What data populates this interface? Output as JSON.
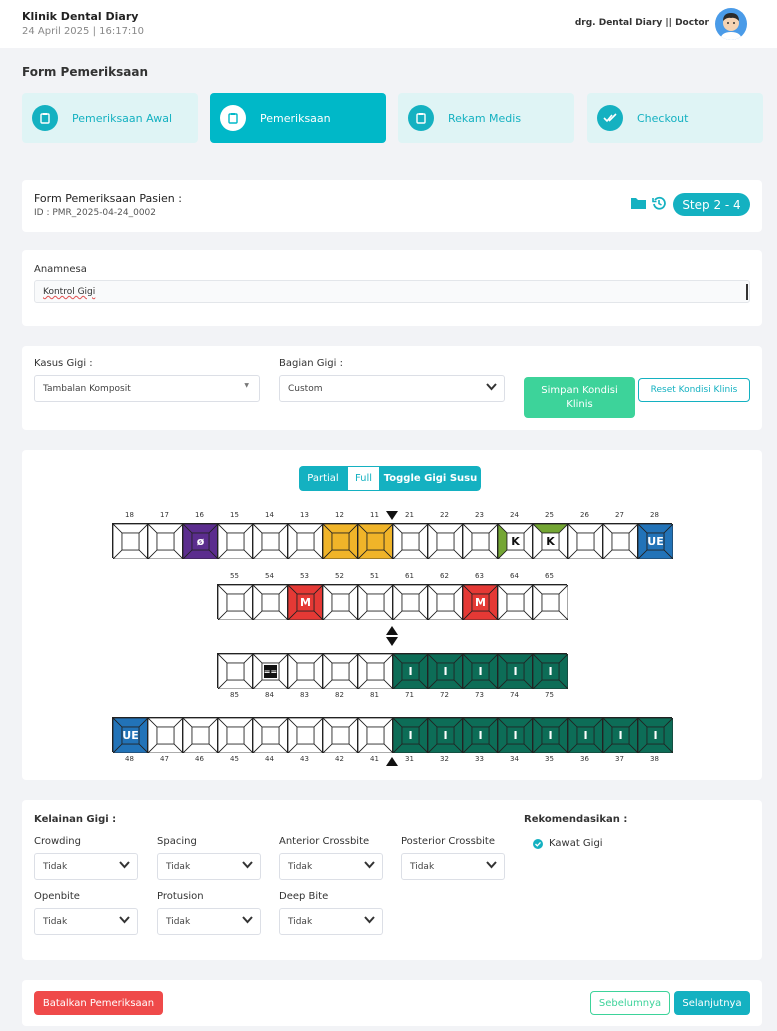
{
  "header": {
    "clinic": "Klinik Dental Diary",
    "datetime": "24 April 2025 | 16:17:10",
    "user": "drg. Dental Diary || Doctor"
  },
  "page_title": "Form Pemeriksaan",
  "steps": [
    {
      "label": "Pemeriksaan Awal"
    },
    {
      "label": "Pemeriksaan"
    },
    {
      "label": "Rekam Medis"
    },
    {
      "label": "Checkout"
    }
  ],
  "patient": {
    "title": "Form Pemeriksaan Pasien :",
    "id": "ID : PMR_2025-04-24_0002",
    "step": "Step 2 - 4"
  },
  "anamnesa": {
    "label": "Anamnesa",
    "value": "Kontrol Gigi"
  },
  "kasus": {
    "label": "Kasus Gigi :",
    "value": "Tambalan Komposit"
  },
  "bagian": {
    "label": "Bagian Gigi :",
    "value": "Custom"
  },
  "buttons": {
    "simpan": "Simpan Kondisi Klinis",
    "reset": "Reset Kondisi Klinis",
    "batal": "Batalkan Pemeriksaan",
    "prev": "Sebelumnya",
    "next": "Selanjutnya"
  },
  "toggle": {
    "partial": "Partial",
    "full": "Full",
    "susu": "Toggle Gigi Susu"
  },
  "odontogram": {
    "row1": [
      {
        "n": "18"
      },
      {
        "n": "17"
      },
      {
        "n": "16",
        "c": "#5b2d8e",
        "m": "ø"
      },
      {
        "n": "15"
      },
      {
        "n": "14"
      },
      {
        "n": "13"
      },
      {
        "n": "12",
        "c": "#f0b429"
      },
      {
        "n": "11",
        "c": "#f0b429"
      },
      {
        "n": "21"
      },
      {
        "n": "22"
      },
      {
        "n": "23"
      },
      {
        "n": "24",
        "c": "#74a634",
        "m": "K",
        "half": true
      },
      {
        "n": "25",
        "c": "#74a634",
        "m": "K",
        "top": true
      },
      {
        "n": "26"
      },
      {
        "n": "27"
      },
      {
        "n": "28",
        "c": "#2273b8",
        "m": "UE"
      }
    ],
    "row2": [
      {
        "n": "55"
      },
      {
        "n": "54"
      },
      {
        "n": "53",
        "c": "#e53935",
        "m": "M"
      },
      {
        "n": "52"
      },
      {
        "n": "51"
      },
      {
        "n": "61"
      },
      {
        "n": "62"
      },
      {
        "n": "63",
        "c": "#e53935",
        "m": "M"
      },
      {
        "n": "64"
      },
      {
        "n": "65"
      }
    ],
    "row3": [
      {
        "n": "85"
      },
      {
        "n": "84",
        "m": "==",
        "blk": true
      },
      {
        "n": "83"
      },
      {
        "n": "82"
      },
      {
        "n": "81"
      },
      {
        "n": "71",
        "c": "#0d6d57",
        "m": "I"
      },
      {
        "n": "72",
        "c": "#0d6d57",
        "m": "I"
      },
      {
        "n": "73",
        "c": "#0d6d57",
        "m": "I"
      },
      {
        "n": "74",
        "c": "#0d6d57",
        "m": "I"
      },
      {
        "n": "75",
        "c": "#0d6d57",
        "m": "I"
      }
    ],
    "row4": [
      {
        "n": "48",
        "c": "#2273b8",
        "m": "UE"
      },
      {
        "n": "47"
      },
      {
        "n": "46"
      },
      {
        "n": "45"
      },
      {
        "n": "44"
      },
      {
        "n": "43"
      },
      {
        "n": "42"
      },
      {
        "n": "41"
      },
      {
        "n": "31",
        "c": "#0d6d57",
        "m": "I"
      },
      {
        "n": "32",
        "c": "#0d6d57",
        "m": "I"
      },
      {
        "n": "33",
        "c": "#0d6d57",
        "m": "I"
      },
      {
        "n": "34",
        "c": "#0d6d57",
        "m": "I"
      },
      {
        "n": "35",
        "c": "#0d6d57",
        "m": "I"
      },
      {
        "n": "36",
        "c": "#0d6d57",
        "m": "I"
      },
      {
        "n": "37",
        "c": "#0d6d57",
        "m": "I"
      },
      {
        "n": "38",
        "c": "#0d6d57",
        "m": "I"
      }
    ]
  },
  "kelainan": {
    "title": "Kelainan Gigi :",
    "items": [
      {
        "label": "Crowding",
        "value": "Tidak"
      },
      {
        "label": "Spacing",
        "value": "Tidak"
      },
      {
        "label": "Anterior Crossbite",
        "value": "Tidak"
      },
      {
        "label": "Posterior Crossbite",
        "value": "Tidak"
      },
      {
        "label": "Openbite",
        "value": "Tidak"
      },
      {
        "label": "Protusion",
        "value": "Tidak"
      },
      {
        "label": "Deep Bite",
        "value": "Tidak"
      }
    ]
  },
  "rekomendasi": {
    "title": "Rekomendasikan :",
    "item": "Kawat Gigi"
  }
}
